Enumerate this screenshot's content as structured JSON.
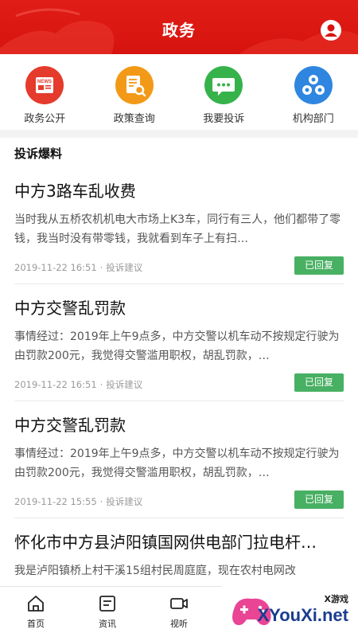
{
  "header": {
    "title": "政务"
  },
  "quick_nav": [
    {
      "label": "政务公开",
      "icon": "news-icon",
      "color": "#e53b2c"
    },
    {
      "label": "政策查询",
      "icon": "document-search-icon",
      "color": "#f29a17"
    },
    {
      "label": "我要投诉",
      "icon": "chat-bubble-icon",
      "color": "#36b24b"
    },
    {
      "label": "机构部门",
      "icon": "organization-icon",
      "color": "#2f86e0"
    }
  ],
  "section": {
    "title": "投诉爆料"
  },
  "feed": [
    {
      "title": "中方3路车乱收费",
      "summary": "当时我从五桥农机机电大市场上K3车，同行有三人，他们都带了零钱，我当时没有带零钱，我就看到车子上有扫…",
      "date": "2019-11-22 16:51",
      "category": "投诉建议",
      "status": "已回复"
    },
    {
      "title": "中方交警乱罚款",
      "summary": "事情经过：2019年上午9点多，中方交警以机车动不按规定行驶为由罚款200元，我觉得交警滥用职权，胡乱罚款，…",
      "date": "2019-11-22 16:51",
      "category": "投诉建议",
      "status": "已回复"
    },
    {
      "title": "中方交警乱罚款",
      "summary": "事情经过：2019年上午9点多，中方交警以机车动不按规定行驶为由罚款200元，我觉得交警滥用职权，胡乱罚款，…",
      "date": "2019-11-22 15:55",
      "category": "投诉建议",
      "status": "已回复"
    },
    {
      "title": "怀化市中方县泸阳镇国网供电部门拉电杆…",
      "summary": "我是泸阳镇桥上村干溪15组村民周庭庭，现在农村电网改"
    }
  ],
  "tabbar": [
    {
      "label": "首页",
      "icon": "home-icon"
    },
    {
      "label": "资讯",
      "icon": "news-list-icon"
    },
    {
      "label": "视听",
      "icon": "video-icon"
    }
  ],
  "watermark": {
    "small": "X游戏",
    "big": "XYouXi.net"
  },
  "colors": {
    "header_red": "#d7130f",
    "badge_green": "#48b063"
  }
}
